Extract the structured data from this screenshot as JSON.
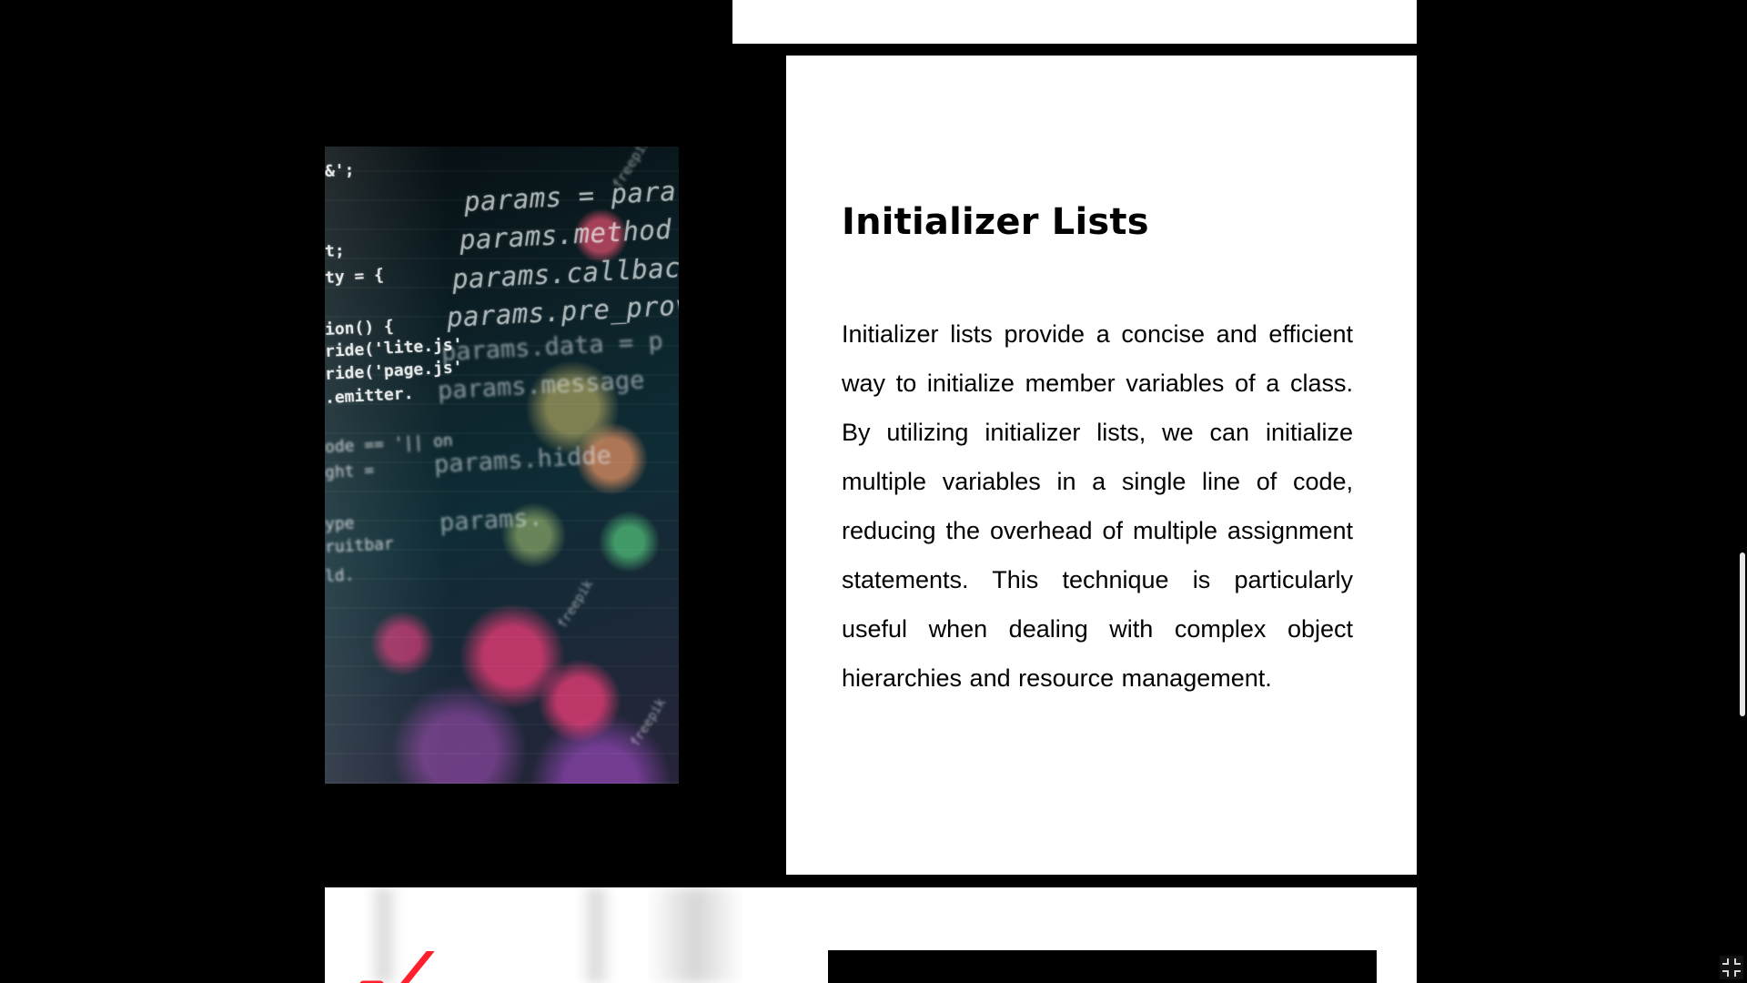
{
  "slide": {
    "title": "Initializer Lists",
    "paragraph": "Initializer lists provide a concise and efficient way to initialize member variables of a class. By utilizing initializer lists, we can initialize multiple variables in a single line of code, reducing the overhead of multiple assignment statements. This technique is particularly useful when dealing with complex object hierarchies and resource management."
  },
  "image": {
    "code_lines": [
      "params = para",
      "params.method",
      "params.callbac",
      "params.pre_prov",
      "params.data = p",
      "params.message",
      "params.hidde",
      "params.",
      "&';",
      "t;",
      "ty = {",
      "ion() {",
      "ride('lite.js'",
      "ride('page.js'",
      ".emitter.",
      "ode == '|| on",
      "ght = ",
      "ype",
      "ruitbar",
      "ld."
    ],
    "watermarks": [
      "freepik",
      "freepik",
      "freepik"
    ]
  },
  "colors": {
    "background": "#000000",
    "slide": "#ffffff",
    "text": "#000000",
    "check_icon": "#ff1f2d"
  },
  "icons": {
    "fullscreen": "fullscreen-exit-icon",
    "bottom_graphic": "check-mark-icon"
  }
}
